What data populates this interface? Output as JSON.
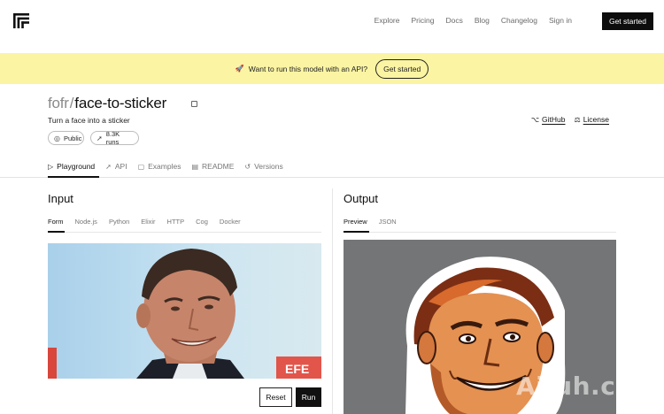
{
  "nav": {
    "logo_icon": "replicate-logo-icon",
    "links": [
      "Explore",
      "Pricing",
      "Docs",
      "Blog",
      "Changelog",
      "Sign in"
    ],
    "cta": "Get started"
  },
  "banner": {
    "icon": "rocket-icon",
    "text": "Want to run this model with an API?",
    "button": "Get started",
    "background": "#fbf4a3"
  },
  "model": {
    "owner": "fofr",
    "separator": "/",
    "name": "face-to-sticker",
    "description": "Turn a face into a sticker",
    "visibility": "Public",
    "runs": "8.3K runs",
    "github": "GitHub",
    "license": "License"
  },
  "tabs": [
    "Playground",
    "API",
    "Examples",
    "README",
    "Versions"
  ],
  "input": {
    "title": "Input",
    "tabs": [
      "Form",
      "Node.js",
      "Python",
      "Elixir",
      "HTTP",
      "Cog",
      "Docker"
    ],
    "reset": "Reset",
    "run": "Run"
  },
  "output": {
    "title": "Output",
    "tabs": [
      "Preview",
      "JSON"
    ]
  },
  "watermark": "AiJuh.com"
}
